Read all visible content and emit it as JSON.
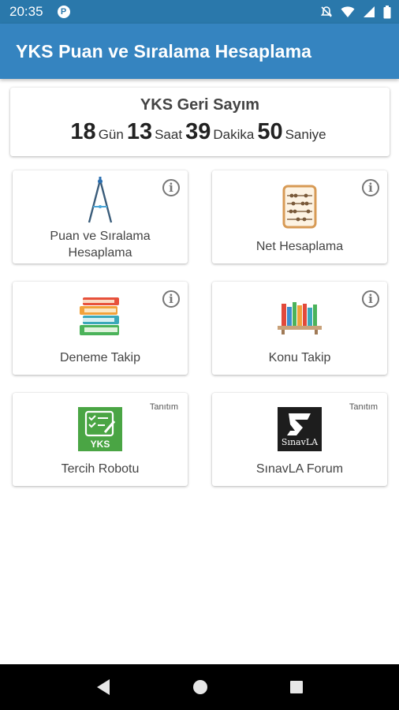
{
  "status_bar": {
    "time": "20:35",
    "icons": [
      "app-notification-icon",
      "mute-icon",
      "wifi-icon",
      "cellular-icon",
      "battery-icon"
    ]
  },
  "app_bar": {
    "title": "YKS Puan ve Sıralama Hesaplama",
    "color": "#3584c0"
  },
  "countdown": {
    "title": "YKS Geri Sayım",
    "days": "18",
    "days_unit": "Gün",
    "hours": "13",
    "hours_unit": "Saat",
    "minutes": "39",
    "minutes_unit": "Dakika",
    "seconds": "50",
    "seconds_unit": "Saniye"
  },
  "tiles": [
    {
      "label_line1": "Puan ve Sıralama",
      "label_line2": "Hesaplama",
      "icon": "compass-icon",
      "has_info": true
    },
    {
      "label": "Net Hesaplama",
      "icon": "abacus-icon",
      "has_info": true
    },
    {
      "label": "Deneme Takip",
      "icon": "books-stack-icon",
      "has_info": true
    },
    {
      "label": "Konu Takip",
      "icon": "bookshelf-icon",
      "has_info": true
    },
    {
      "label": "Tercih Robotu",
      "icon": "yks-checklist-icon",
      "tag": "Tanıtım",
      "icon_text": "YKS"
    },
    {
      "label": "SınavLA Forum",
      "icon": "sinavla-logo-icon",
      "tag": "Tanıtım",
      "icon_text": "SınavLA"
    }
  ],
  "nav_bar": {
    "icons": [
      "back-icon",
      "home-icon",
      "recents-icon"
    ]
  }
}
